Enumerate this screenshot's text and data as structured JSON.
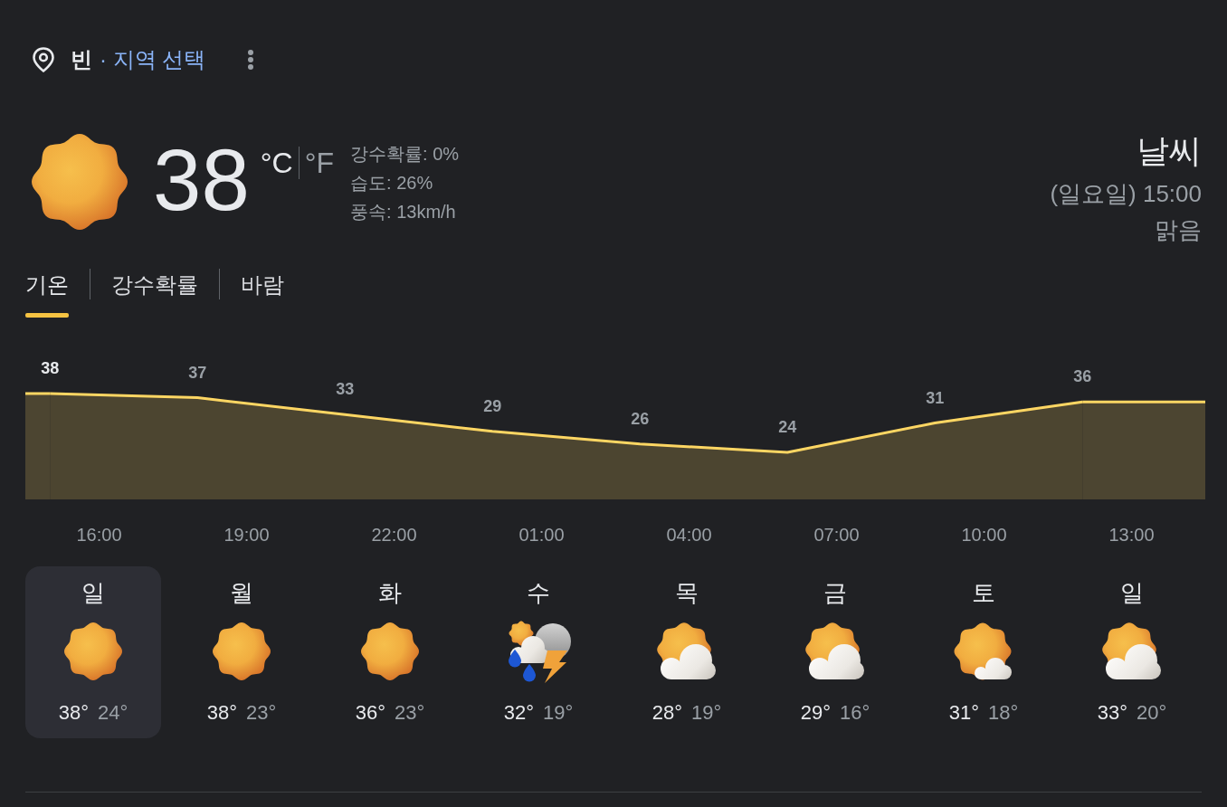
{
  "header": {
    "location": "빈",
    "change_location_link": "· 지역 선택"
  },
  "current": {
    "icon": {
      "kind": "sunny"
    },
    "temperature": "38",
    "units": [
      {
        "label": "°C",
        "selected": true
      },
      {
        "label": "°F",
        "selected": false
      }
    ],
    "details": [
      "강수확률: 0%",
      "습도: 26%",
      "풍속: 13km/h"
    ],
    "title": "날씨",
    "time": "(일요일) 15:00",
    "description": "맑음"
  },
  "tabs": [
    {
      "label": "기온",
      "selected": true
    },
    {
      "label": "강수확률",
      "selected": false
    },
    {
      "label": "바람",
      "selected": false
    }
  ],
  "temperature_chart": {
    "chart_data": {
      "type": "area",
      "categories": [
        null,
        "16:00",
        null,
        null,
        "19:00",
        null,
        null,
        "22:00",
        null,
        null,
        "01:00",
        null,
        null,
        "04:00",
        null,
        null,
        "07:00",
        null,
        null,
        "10:00",
        null,
        null,
        "13:00",
        null
      ],
      "series": [
        {
          "color": "#fdd663",
          "values": [
            38,
            null,
            null,
            37,
            null,
            null,
            33,
            null,
            null,
            29,
            null,
            null,
            26,
            null,
            null,
            24,
            null,
            null,
            31,
            null,
            null,
            36,
            null,
            null
          ]
        }
      ],
      "data_labels": true
    },
    "point_labels": [
      {
        "selected": true
      },
      {
        "selected": false
      },
      {
        "selected": false
      },
      {
        "selected": false
      },
      {
        "selected": false
      },
      {
        "selected": false
      },
      {
        "selected": false
      },
      {
        "selected": false
      }
    ]
  },
  "days": [
    {
      "day": "일",
      "kind": "sunny",
      "high": "38°",
      "low": "24°",
      "selected": true
    },
    {
      "day": "월",
      "kind": "sunny",
      "high": "38°",
      "low": "23°",
      "selected": false
    },
    {
      "day": "화",
      "kind": "sunny",
      "high": "36°",
      "low": "23°",
      "selected": false
    },
    {
      "day": "수",
      "kind": "storm",
      "high": "32°",
      "low": "19°",
      "selected": false
    },
    {
      "day": "목",
      "kind": "partly_cloudy",
      "high": "28°",
      "low": "19°",
      "selected": false
    },
    {
      "day": "금",
      "kind": "partly_cloudy",
      "high": "29°",
      "low": "16°",
      "selected": false
    },
    {
      "day": "토",
      "kind": "mostly_sunny",
      "high": "31°",
      "low": "18°",
      "selected": false
    },
    {
      "day": "일",
      "kind": "partly_cloudy",
      "high": "33°",
      "low": "20°",
      "selected": false
    }
  ]
}
